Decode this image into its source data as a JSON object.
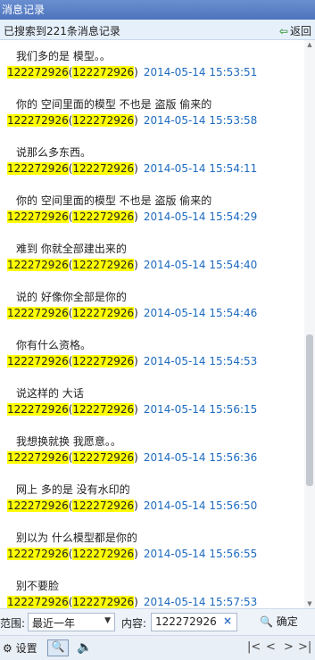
{
  "window": {
    "title": "消息记录"
  },
  "info": {
    "summary": "已搜索到221条消息记录",
    "back_label": "返回"
  },
  "messages": [
    {
      "text": "我们多的是  模型。。",
      "sender": "122272926",
      "sender_id": "122272926",
      "time": "2014-05-14 15:53:51"
    },
    {
      "text": "你的  空间里面的模型  不也是  盗版  偷来的",
      "sender": "122272926",
      "sender_id": "122272926",
      "time": "2014-05-14 15:53:58"
    },
    {
      "text": "说那么多东西。",
      "sender": "122272926",
      "sender_id": "122272926",
      "time": "2014-05-14 15:54:11"
    },
    {
      "text": "你的  空间里面的模型  不也是  盗版  偷来的",
      "sender": "122272926",
      "sender_id": "122272926",
      "time": "2014-05-14 15:54:29"
    },
    {
      "text": "难到  你就全部建出来的",
      "sender": "122272926",
      "sender_id": "122272926",
      "time": "2014-05-14 15:54:40"
    },
    {
      "text": "说的  好像你全部是你的",
      "sender": "122272926",
      "sender_id": "122272926",
      "time": "2014-05-14 15:54:46"
    },
    {
      "text": "你有什么资格。",
      "sender": "122272926",
      "sender_id": "122272926",
      "time": "2014-05-14 15:54:53"
    },
    {
      "text": "说这样的  大话",
      "sender": "122272926",
      "sender_id": "122272926",
      "time": "2014-05-14 15:56:15"
    },
    {
      "text": "我想换就换  我愿意。。",
      "sender": "122272926",
      "sender_id": "122272926",
      "time": "2014-05-14 15:56:36"
    },
    {
      "text": "网上  多的是  没有水印的",
      "sender": "122272926",
      "sender_id": "122272926",
      "time": "2014-05-14 15:56:50"
    },
    {
      "text": "别以为  什么模型都是你的",
      "sender": "122272926",
      "sender_id": "122272926",
      "time": "2014-05-14 15:56:55"
    },
    {
      "text": "别不要脸",
      "sender": "122272926",
      "sender_id": "122272926",
      "time": "2014-05-14 15:57:53"
    }
  ],
  "filter": {
    "range_label": "范围:",
    "range_value": "最近一年",
    "content_label": "内容:",
    "content_value": "122272926",
    "confirm_label": "确定"
  },
  "toolbar": {
    "settings_label": "设置"
  },
  "colors": {
    "highlight": "#ffff00",
    "time_text": "#1d6bbf",
    "title_bar": "#4d73bd"
  }
}
